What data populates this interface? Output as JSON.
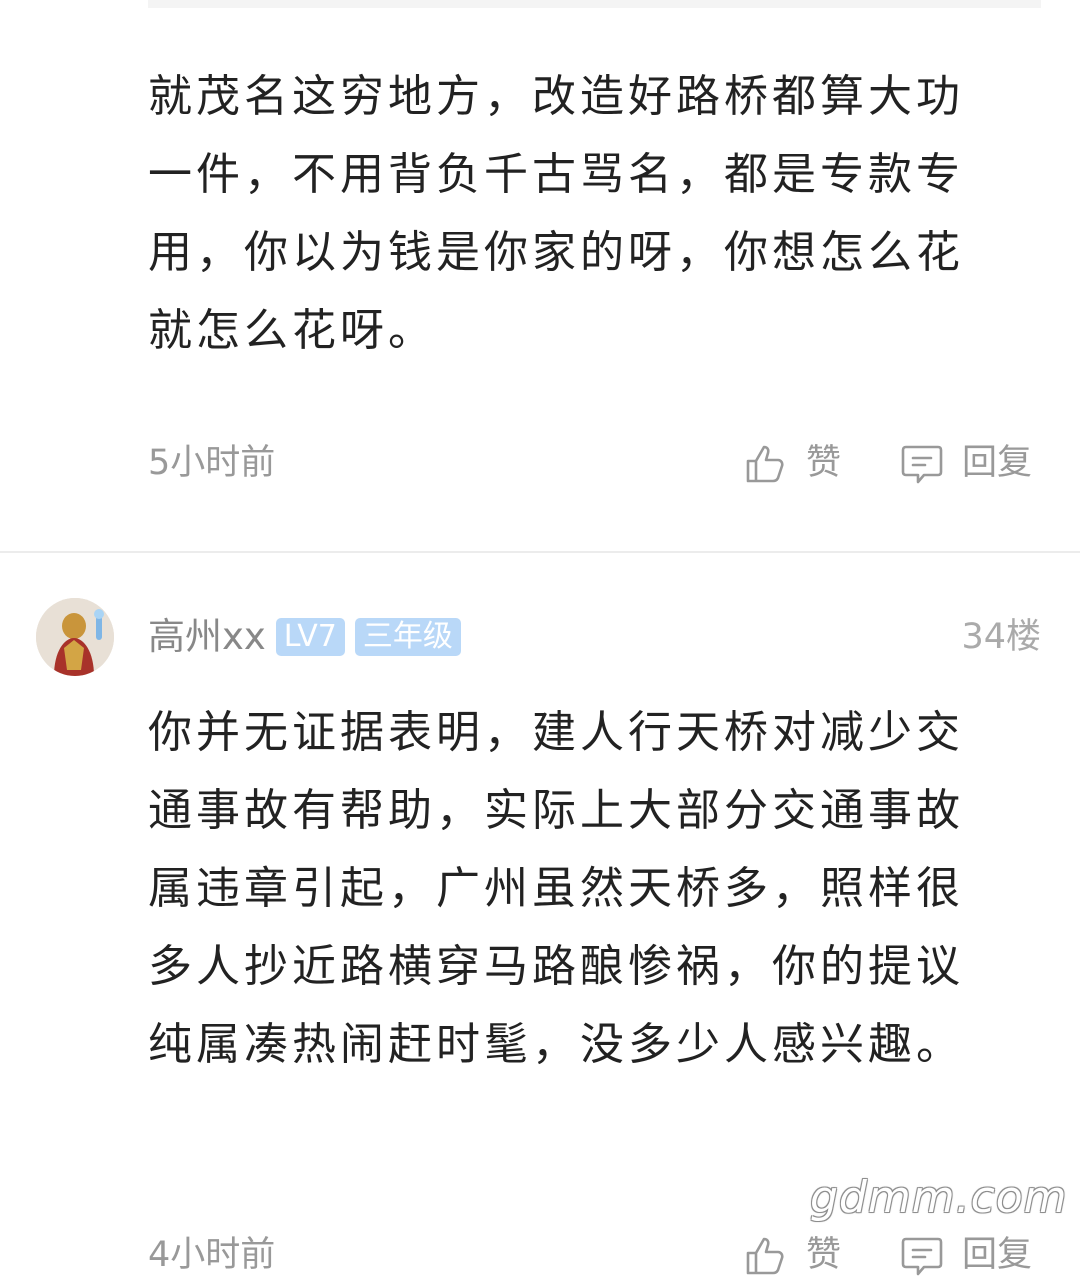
{
  "comment_1": {
    "text": "就茂名这穷地方，改造好路桥都算大功一件，不用背负千古骂名，都是专款专用，你以为钱是你家的呀，你想怎么花就怎么花呀。",
    "time": "5小时前",
    "like_label": "赞",
    "reply_label": "回复"
  },
  "comment_2": {
    "username": "高州xx",
    "level_badge": "LV7",
    "grade_badge": "三年级",
    "floor": "34楼",
    "text": "你并无证据表明，建人行天桥对减少交通事故有帮助，实际上大部分交通事故属违章引起，广州虽然天桥多，照样很多人抄近路横穿马路酿惨祸，你的提议纯属凑热闹赶时髦，没多少人感兴趣。",
    "time": "4小时前",
    "like_label": "赞",
    "reply_label": "回复"
  },
  "watermark": "gdmm.com",
  "icons": {
    "like": "thumbs-up-icon",
    "reply": "comment-bubble-icon",
    "avatar": "user-avatar"
  },
  "colors": {
    "badge": "#b9d8f8",
    "meta_text": "#999999",
    "body_text": "#222222"
  }
}
